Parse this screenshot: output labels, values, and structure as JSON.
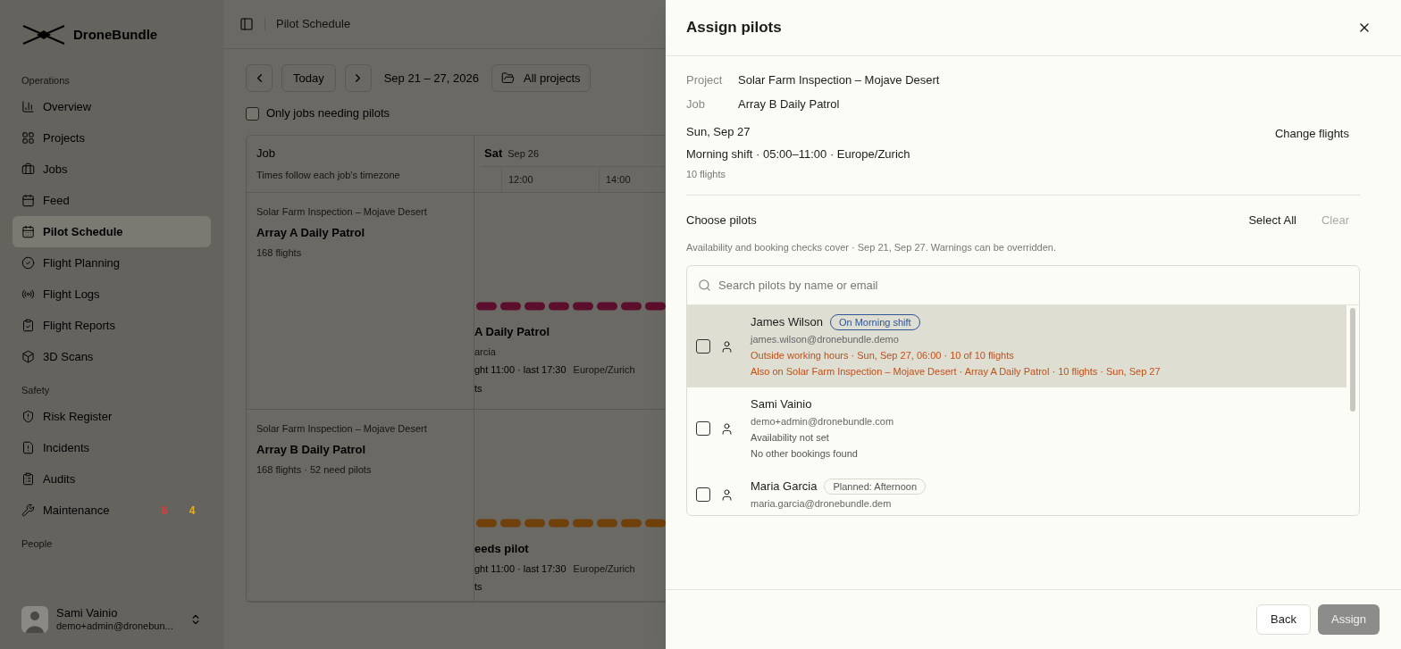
{
  "sidebar": {
    "brand": "DroneBundle",
    "sections": [
      {
        "title": "Operations",
        "items": [
          {
            "label": "Overview",
            "selected": false
          },
          {
            "label": "Projects",
            "selected": false
          },
          {
            "label": "Jobs",
            "selected": false
          },
          {
            "label": "Feed",
            "selected": false
          },
          {
            "label": "Pilot Schedule",
            "selected": true
          },
          {
            "label": "Flight Planning",
            "selected": false
          },
          {
            "label": "Flight Logs",
            "selected": false
          },
          {
            "label": "Flight Reports",
            "selected": false
          },
          {
            "label": "3D Scans",
            "selected": false
          }
        ]
      },
      {
        "title": "Safety",
        "items": [
          {
            "label": "Risk Register",
            "selected": false
          },
          {
            "label": "Incidents",
            "selected": false
          },
          {
            "label": "Audits",
            "selected": false
          },
          {
            "label": "Maintenance",
            "selected": false,
            "badges": [
              {
                "text": "6",
                "color": "#e23b3b"
              },
              {
                "text": "4",
                "color": "#e8b020"
              }
            ]
          }
        ]
      },
      {
        "title": "People"
      }
    ],
    "user": {
      "name": "Sami Vainio",
      "email": "demo+admin@dronebun..."
    }
  },
  "main": {
    "breadcrumb": "Pilot Schedule",
    "toolbar": {
      "today": "Today",
      "range": "Sep 21 – 27, 2026",
      "projects": "All projects"
    },
    "filter": {
      "label": "Only jobs needing pilots",
      "checked": false
    },
    "table": {
      "job_header": "Job",
      "job_subheader": "Times follow each job's timezone",
      "day": "Sat",
      "date": "Sep 26",
      "times": [
        "12:00",
        "14:00"
      ],
      "rows": [
        {
          "project": "Solar Farm Inspection – Mojave Desert",
          "job": "Array A Daily Patrol",
          "meta": "168 flights",
          "color": "#5c0f2c",
          "card": {
            "title": "A Daily Patrol",
            "subtitle": "arcia",
            "time": "ght 11:00 · last 17:30",
            "timezone": "Europe/Zurich",
            "footer": "ts"
          }
        },
        {
          "project": "Solar Farm Inspection – Mojave Desert",
          "job": "Array B Daily Patrol",
          "meta": "168 flights · 52 need pilots",
          "color": "#70400a",
          "card": {
            "title": "eeds pilot",
            "time": "ght 11:00 · last 17:30",
            "timezone": "Europe/Zurich",
            "footer": "ts"
          }
        }
      ]
    }
  },
  "dialog": {
    "title": "Assign pilots",
    "details": [
      {
        "label": "Project",
        "value": "Solar Farm Inspection – Mojave Desert"
      },
      {
        "label": "Job",
        "value": "Array B Daily Patrol"
      }
    ],
    "date": "Sun, Sep 27",
    "shift": "Morning shift · 05:00–11:00 · Europe/Zurich",
    "flights": "10 flights",
    "change_flights": "Change flights",
    "choose_title": "Choose pilots",
    "select_all": "Select All",
    "clear": {
      "label": "Clear",
      "disabled": true
    },
    "note": "Availability and booking checks cover · Sep 21, Sep 27. Warnings can be overridden.",
    "search": {
      "placeholder": "Search pilots by name or email"
    },
    "pilots": [
      {
        "name": "James Wilson",
        "email": "james.wilson@dronebundle.demo",
        "highlighted": true,
        "checked": false,
        "badge": {
          "text": "On Morning shift",
          "kind": "info"
        },
        "lines": [
          {
            "text": "Outside working hours · Sun, Sep 27, 06:00 · 10 of 10 flights",
            "kind": "warning"
          },
          {
            "text": "Also on Solar Farm Inspection – Mojave Desert · Array A Daily Patrol · 10 flights · Sun, Sep 27",
            "kind": "warning"
          }
        ]
      },
      {
        "name": "Sami Vainio",
        "email": "demo+admin@dronebundle.com",
        "highlighted": false,
        "checked": false,
        "lines": [
          {
            "text": "Availability not set",
            "kind": "note"
          },
          {
            "text": "No other bookings found",
            "kind": "note"
          }
        ]
      },
      {
        "name": "Maria Garcia",
        "email": "maria.garcia@dronebundle.dem",
        "highlighted": false,
        "checked": false,
        "badge": {
          "text": "Planned: Afternoon",
          "kind": "neutral"
        }
      }
    ],
    "buttons": [
      {
        "label": "Back",
        "kind": "secondary",
        "disabled": false
      },
      {
        "label": "Assign",
        "kind": "primary",
        "disabled": true
      }
    ]
  }
}
